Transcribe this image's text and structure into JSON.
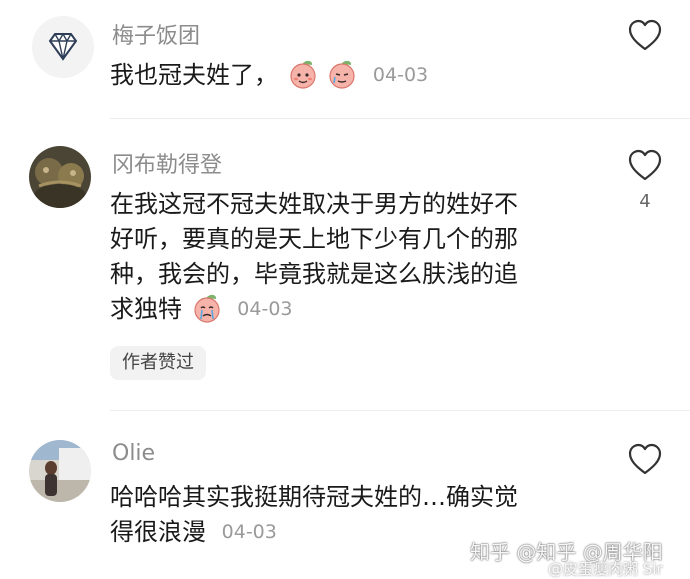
{
  "comments": [
    {
      "username": "梅子饭团",
      "lines": [
        "我也冠夫姓了，"
      ],
      "emoji": [
        "peach-face-emoji",
        "peach-face-emoji"
      ],
      "date": "04-03",
      "like_count": ""
    },
    {
      "username": "冈布勒得登",
      "lines": [
        "在我这冠不冠夫姓取决于男方的姓好不",
        "好听，要真的是天上地下少有几个的那",
        "种，我会的，毕竟我就是这么肤浅的追",
        "求独特"
      ],
      "emoji": [
        "peach-cry-emoji"
      ],
      "date": "04-03",
      "like_count": "4",
      "author_tag": "作者赞过"
    },
    {
      "username": "Olie",
      "lines": [
        "哈哈哈其实我挺期待冠夫姓的…确实觉",
        "得很浪漫"
      ],
      "date": "04-03",
      "like_count": ""
    }
  ],
  "watermark": {
    "main": "知乎 @知乎 @周华阳",
    "sub": "@皮蛋瘦肉粥 Sir"
  },
  "colors": {
    "text": "#1a1a1a",
    "username": "#8c8c8c",
    "meta": "#9a9a9a",
    "heart_outline": "#333333",
    "peach": "#f4a29b"
  }
}
